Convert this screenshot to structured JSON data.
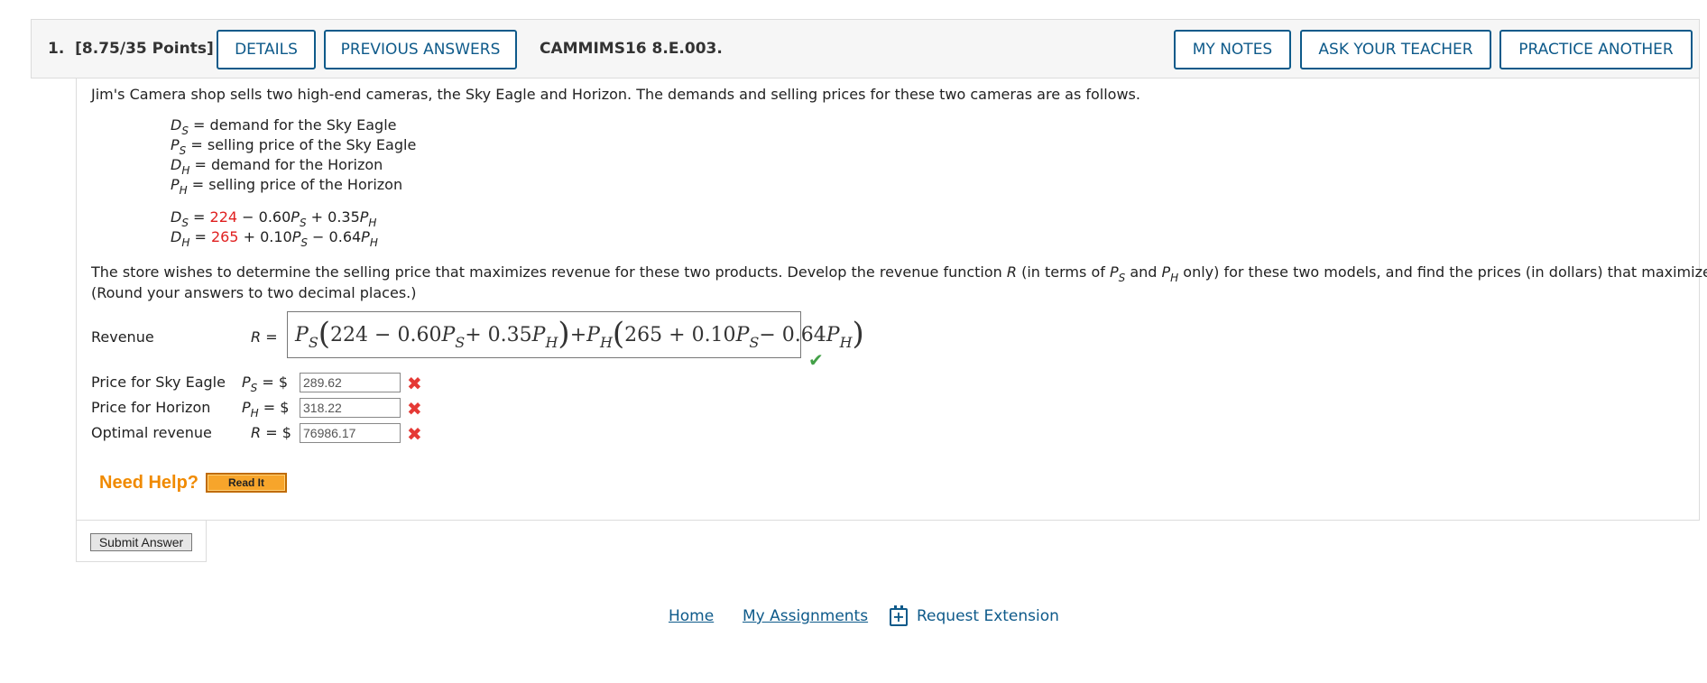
{
  "header": {
    "question_number": "1.",
    "points": "[8.75/35 Points]",
    "details_label": "DETAILS",
    "previous_answers_label": "PREVIOUS ANSWERS",
    "code": "CAMMIMS16 8.E.003.",
    "my_notes_label": "MY NOTES",
    "ask_teacher_label": "ASK YOUR TEACHER",
    "practice_another_label": "PRACTICE ANOTHER"
  },
  "problem": {
    "intro": "Jim's Camera shop sells two high-end cameras, the Sky Eagle and Horizon. The demands and selling prices for these two cameras are as follows.",
    "definitions": [
      {
        "var": "D",
        "sub": "S",
        "text": " = demand for the Sky Eagle"
      },
      {
        "var": "P",
        "sub": "S",
        "text": " = selling price of the Sky Eagle"
      },
      {
        "var": "D",
        "sub": "H",
        "text": " = demand for the Horizon"
      },
      {
        "var": "P",
        "sub": "H",
        "text": " = selling price of the Horizon"
      }
    ],
    "eq1": {
      "lhs_var": "D",
      "lhs_sub": "S",
      "eq": " = ",
      "const": "224",
      "t1": " − 0.60",
      "v1": "P",
      "s1": "S",
      "t2": " + 0.35",
      "v2": "P",
      "s2": "H"
    },
    "eq2": {
      "lhs_var": "D",
      "lhs_sub": "H",
      "eq": " = ",
      "const": "265",
      "t1": " + 0.10",
      "v1": "P",
      "s1": "S",
      "t2": " − 0.64",
      "v2": "P",
      "s2": "H"
    },
    "task_line1_a": "The store wishes to determine the selling price that maximizes revenue for these two products. Develop the revenue function ",
    "task_R": "R",
    "task_line1_b": " (in terms of ",
    "task_and": " and ",
    "task_line1_c": " only) for these two models, and find the prices (in dollars) that maximizes revenue.",
    "task_line2": "(Round your answers to two decimal places.)"
  },
  "answers": {
    "revenue_label": "Revenue",
    "revenue_var": "R",
    "eq_sign": "=",
    "revenue_expression": {
      "p1": "P",
      "p1s": "S",
      "a": "224 − 0.60",
      "b": "P",
      "bs": "S",
      "c": " + 0.35",
      "d": "P",
      "ds": "H",
      "plus": " + ",
      "p2": "P",
      "p2s": "H",
      "e": "265 + 0.10",
      "f": "P",
      "fs": "S",
      "g": " − 0.64",
      "h": "P",
      "hs": "H"
    },
    "currency": "$",
    "rows": [
      {
        "label": "Price for Sky Eagle",
        "var": "P",
        "sub": "S",
        "value": "289.62"
      },
      {
        "label": "Price for Horizon",
        "var": "P",
        "sub": "H",
        "value": "318.22"
      },
      {
        "label": "Optimal revenue",
        "var": "R",
        "sub": "",
        "value": "76986.17"
      }
    ],
    "correct_mark": "✔",
    "wrong_mark": "✖"
  },
  "help": {
    "need_help": "Need Help?",
    "read_it": "Read It"
  },
  "submit_label": "Submit Answer",
  "footer": {
    "home": "Home",
    "my_assignments": "My Assignments",
    "request_extension": "Request Extension"
  },
  "colors": {
    "accent": "#0e5a8a",
    "highlight_number": "#e02020",
    "correct": "#43a047",
    "wrong": "#e53935",
    "help": "#f08a00"
  },
  "icons": {
    "correct": "check-icon",
    "wrong": "x-icon",
    "extension": "calendar-plus-icon"
  }
}
